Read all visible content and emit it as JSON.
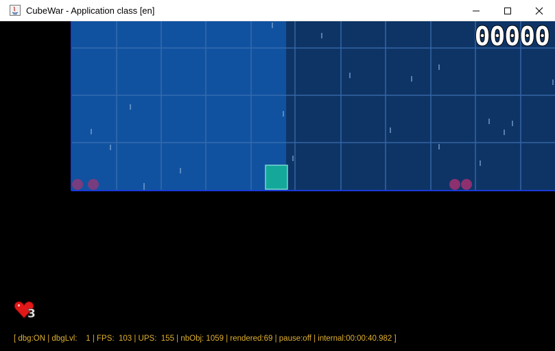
{
  "window": {
    "title": "CubeWar - Application class [en]",
    "icon": "java-app-icon",
    "controls": [
      "minimize",
      "maximize",
      "close"
    ]
  },
  "hud": {
    "score": "00000",
    "lives": "3",
    "lives_icon": "heart-icon",
    "debug_line": "[ dbg:ON | dbgLvl:    1 | FPS:  103 | UPS:  155 | nbObj: 1059 | rendered:69 | pause:off | internal:00:00:40.982 ]"
  },
  "colors": {
    "play_area_light": "#1152a0",
    "play_area_dark": "#0e3466",
    "grid_line": "#3a6fb0",
    "floor_line": "#1a3ad8",
    "player": "#14a89a",
    "enemy": "#8a3a78",
    "debug_text": "#e0b030"
  }
}
